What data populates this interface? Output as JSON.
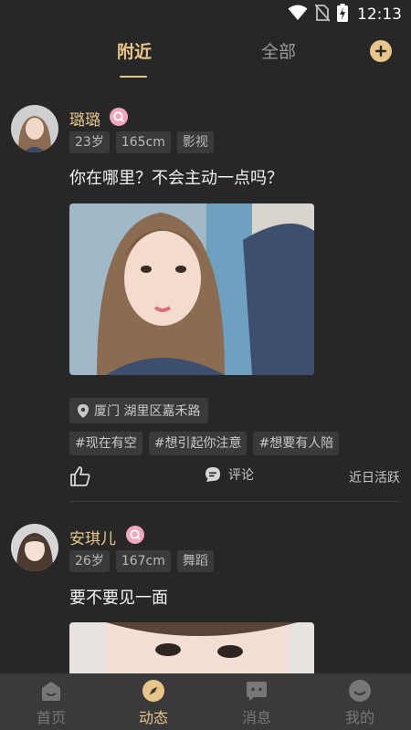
{
  "status_bar": {
    "time": "12:13"
  },
  "top_tabs": {
    "nearby": "附近",
    "all": "全部",
    "active": "nearby"
  },
  "posts": [
    {
      "username": "璐璐",
      "tags": [
        "23岁",
        "165cm",
        "影视"
      ],
      "text": "你在哪里？不会主动一点吗？",
      "location": "厦门 湖里区嘉禾路",
      "hashtags": [
        "#现在有空",
        "#想引起你注意",
        "#想要有人陪"
      ],
      "comment_label": "评论",
      "active_status": "近日活跃"
    },
    {
      "username": "安琪儿",
      "tags": [
        "26岁",
        "167cm",
        "舞蹈"
      ],
      "text": "要不要见一面"
    }
  ],
  "bottom_nav": {
    "items": [
      {
        "label": "首页",
        "icon": "home-icon"
      },
      {
        "label": "动态",
        "icon": "compass-icon"
      },
      {
        "label": "消息",
        "icon": "message-icon"
      },
      {
        "label": "我的",
        "icon": "profile-icon"
      }
    ],
    "active": 1
  },
  "colors": {
    "background": "#272727",
    "accent": "#e8c68a",
    "chip": "#3a3a3a",
    "badge": "#f2a6bc",
    "nav_bg": "#3a3a3a"
  }
}
